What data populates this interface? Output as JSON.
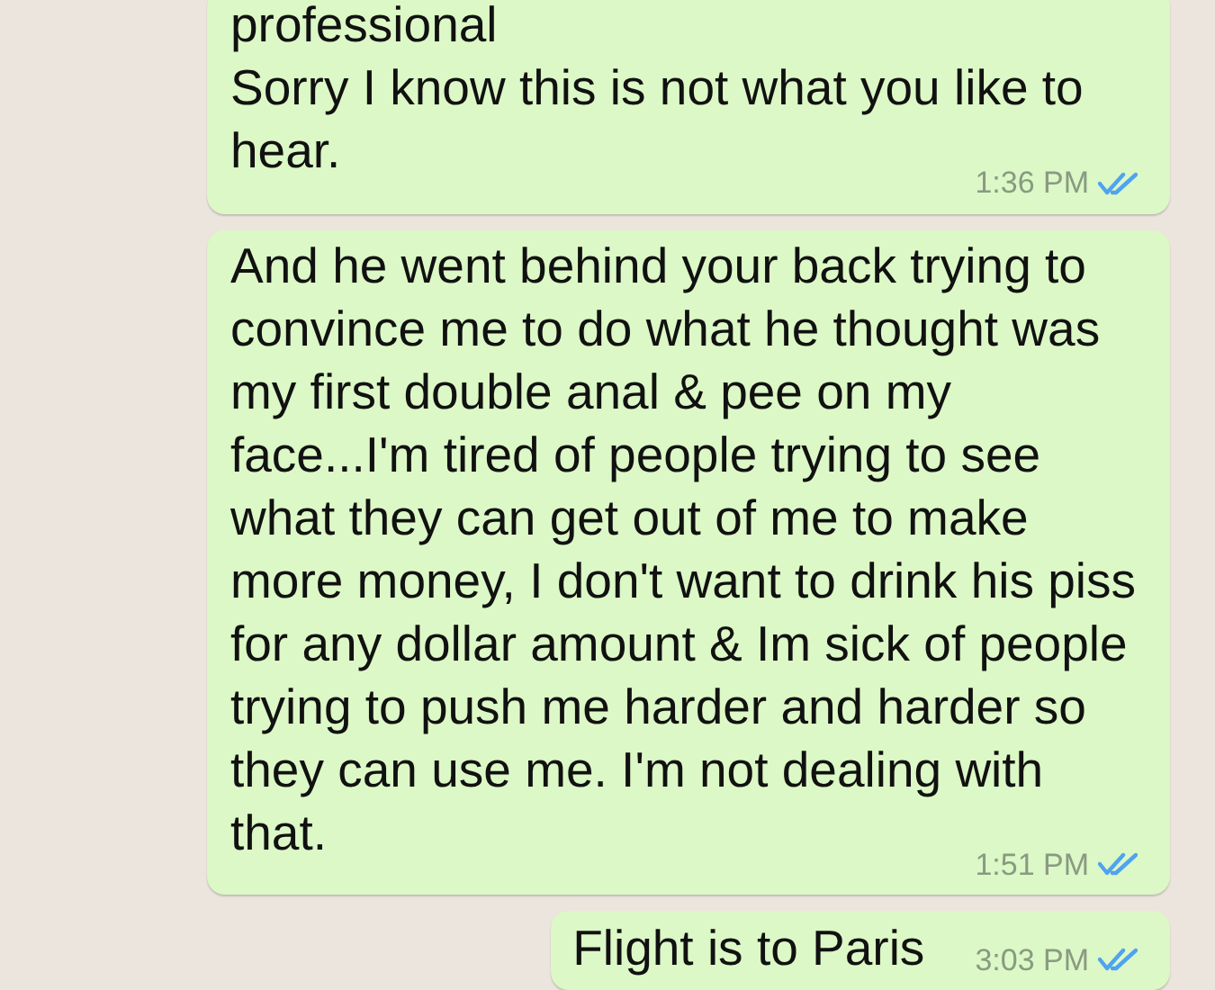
{
  "messages": [
    {
      "text": "professional\nSorry I know this is not what you like to hear.",
      "time": "1:36 PM",
      "read": true
    },
    {
      "text": "And he went behind your back trying to convince me to do what he thought was my first double anal & pee on my face...I'm tired of people trying to see what they can get out of me to make more money, I don't want to drink his piss for any dollar amount & Im sick of people trying to push me harder and harder so they can use me. I'm not dealing with that.",
      "time": "1:51 PM",
      "read": true
    },
    {
      "text": "Flight is to Paris",
      "time": "3:03 PM",
      "read": true
    }
  ]
}
